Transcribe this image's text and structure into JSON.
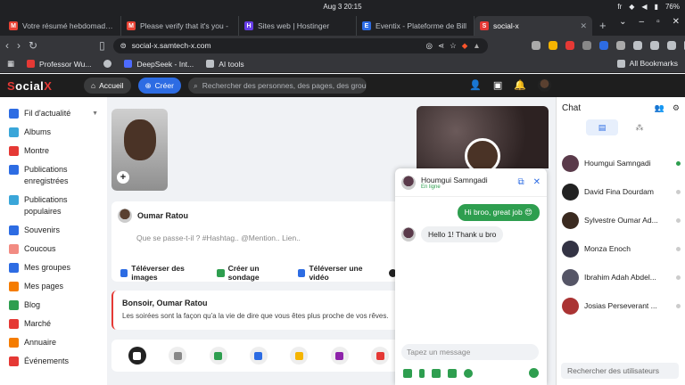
{
  "system": {
    "clock": "Aug 3  20:15",
    "lang": "fr",
    "battery": "76%"
  },
  "tabs": [
    {
      "label": "Votre résumé hebdomadaire",
      "favicon": "M",
      "color": "#ea4335"
    },
    {
      "label": "Please verify that it's you - ",
      "favicon": "M",
      "color": "#ea4335"
    },
    {
      "label": "Sites web | Hostinger",
      "favicon": "H",
      "color": "#673de6"
    },
    {
      "label": "Eventix - Plateforme de Bill",
      "favicon": "E",
      "color": "#2d6ce3"
    },
    {
      "label": "social-x",
      "favicon": "S",
      "color": "#e53935",
      "active": true
    }
  ],
  "browser": {
    "url": "social-x.samtech-x.com",
    "new_tab": "+"
  },
  "bookmarks": [
    {
      "label": "Professor Wu...",
      "color": "#e53935"
    },
    {
      "label": "",
      "color": "#bdc1c6"
    },
    {
      "label": "DeepSeek - Int...",
      "color": "#4d6bfe"
    },
    {
      "label": "AI tools",
      "color": "#bdc1c6"
    }
  ],
  "bookmarks_all": "All Bookmarks",
  "app": {
    "logo_pre": "S",
    "logo_mid": "ocial",
    "logo_post": "X",
    "home": "Accueil",
    "create": "Créer",
    "search_placeholder": "Rechercher des personnes, des pages, des groupes"
  },
  "sidebar": [
    {
      "label": "Fil d'actualité",
      "color": "#2d6ce3",
      "caret": "▼"
    },
    {
      "label": "Albums",
      "color": "#3aa6d9"
    },
    {
      "label": "Montre",
      "color": "#e53935"
    },
    {
      "label": "Publications enregistrées",
      "color": "#2d6ce3"
    },
    {
      "label": "Publications populaires",
      "color": "#3aa6d9"
    },
    {
      "label": "Souvenirs",
      "color": "#2d6ce3"
    },
    {
      "label": "Coucous",
      "color": "#f28b82"
    },
    {
      "label": "Mes groupes",
      "color": "#2d6ce3"
    },
    {
      "label": "Mes pages",
      "color": "#f57c00"
    },
    {
      "label": "Blog",
      "color": "#2e9e4f"
    },
    {
      "label": "Marché",
      "color": "#e53935"
    },
    {
      "label": "Annuaire",
      "color": "#f57c00"
    },
    {
      "label": "Événements",
      "color": "#e53935"
    }
  ],
  "composer": {
    "author": "Oumar Ratou",
    "placeholder": "Que se passe-t-il ? #Hashtag.. @Mention.. Lien..",
    "actions": [
      {
        "label": "Téléverser des images",
        "color": "#2d6ce3"
      },
      {
        "label": "Créer un sondage",
        "color": "#2e9e4f"
      },
      {
        "label": "Téléverser une vidéo",
        "color": "#2d6ce3"
      },
      {
        "label": "P",
        "color": "#222"
      }
    ]
  },
  "greeting": {
    "title": "Bonsoir, Oumar Ratou",
    "text": "Les soirées sont la façon qu'a la vie de dire que vous êtes plus proche de vos rêves."
  },
  "feelings": [
    "#222",
    "#888",
    "#2e9e4f",
    "#2d6ce3",
    "#f5b400",
    "#8e24aa",
    "#e53935"
  ],
  "chat_window": {
    "name": "Houmgui Samngadi",
    "status": "En ligne",
    "outgoing": "Hi broo, great job 😍",
    "incoming": "Hello 1! Thank u bro",
    "input_placeholder": "Tapez un message"
  },
  "chat_panel": {
    "title": "Chat",
    "search_placeholder": "Rechercher des utilisateurs",
    "users": [
      {
        "name": "Houmgui Samngadi",
        "online": true,
        "color": "#5a3a4a"
      },
      {
        "name": "David Fina Dourdam",
        "online": false,
        "color": "#222"
      },
      {
        "name": "Sylvestre Oumar Ad...",
        "online": false,
        "color": "#3a2a20"
      },
      {
        "name": "Monza Enoch",
        "online": false,
        "color": "#334"
      },
      {
        "name": "Ibrahim Adah Abdel...",
        "online": false,
        "color": "#556"
      },
      {
        "name": "Josias Perseverant ...",
        "online": false,
        "color": "#a33"
      }
    ]
  }
}
